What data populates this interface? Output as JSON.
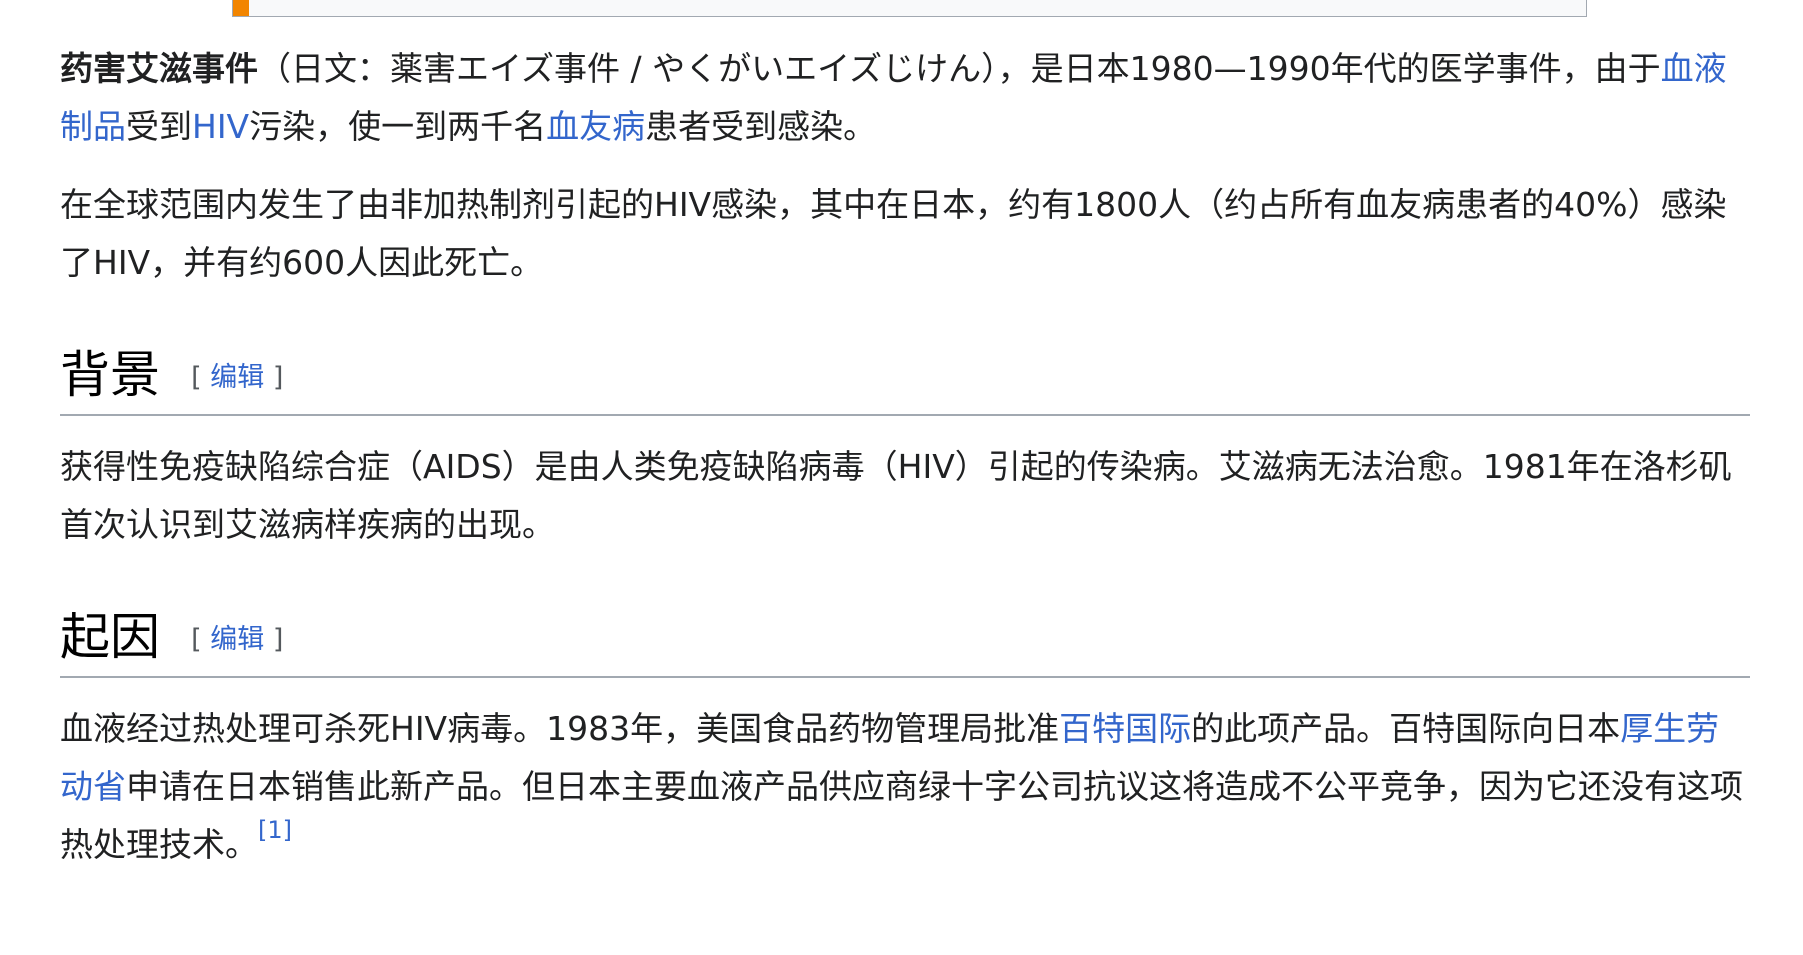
{
  "intro": {
    "p1": {
      "bold_title": "药害艾滋事件",
      "t1": "（日文：薬害エイズ事件 / やくがいエイズじけん），是日本1980—1990年代的医学事件，由于",
      "link1": "血液制品",
      "t2": "受到",
      "link2": "HIV",
      "t3": "污染，使一到两千名",
      "link3": "血友病",
      "t4": "患者受到感染。"
    },
    "p2": "在全球范围内发生了由非加热制剂引起的HIV感染，其中在日本，约有1800人（约占所有血友病患者的40%）感染了HIV，并有约600人因此死亡。"
  },
  "edit": {
    "open": "[",
    "label": "编辑",
    "close": "]"
  },
  "section_background": {
    "title": "背景",
    "p1": "获得性免疫缺陷综合症（AIDS）是由人类免疫缺陷病毒（HIV）引起的传染病。艾滋病无法治愈。1981年在洛杉矶首次认识到艾滋病样疾病的出现。"
  },
  "section_cause": {
    "title": "起因",
    "t1": "血液经过热处理可杀死HIV病毒。1983年，美国食品药物管理局批准",
    "link1": "百特国际",
    "t2": "的此项产品。百特国际向日本",
    "link2": "厚生劳动省",
    "t3": "申请在日本销售此新产品。但日本主要血液产品供应商绿十字公司抗议这将造成不公平竞争，因为它还没有这项热处理技术。",
    "ref": "[1]"
  },
  "colors": {
    "link": "#3366cc",
    "text": "#202122",
    "accent": "#f28500",
    "rule": "#a2a9b1"
  }
}
